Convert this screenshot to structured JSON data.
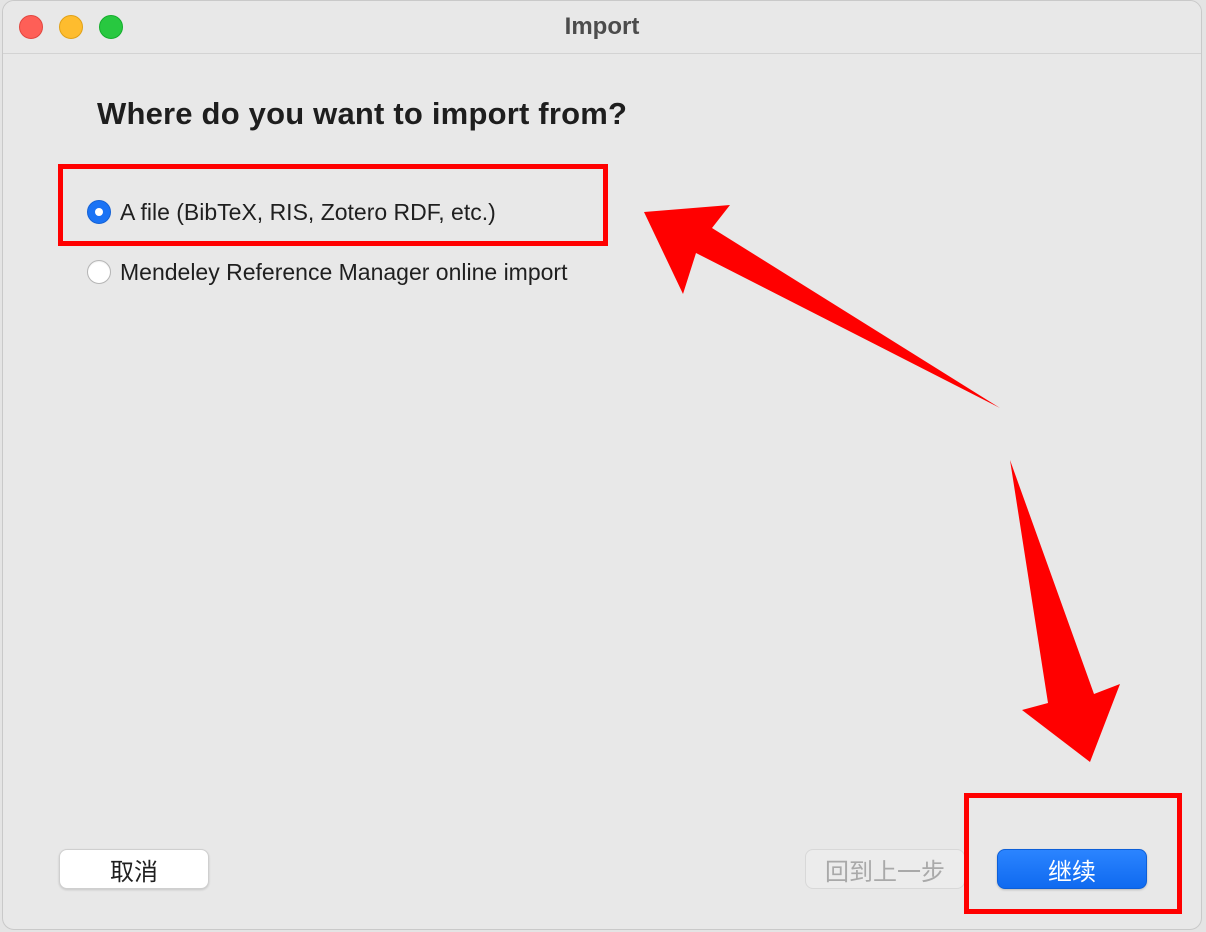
{
  "window": {
    "title": "Import",
    "traffic_lights": [
      "close",
      "minimize",
      "maximize"
    ]
  },
  "wizard": {
    "question": "Where do you want to import from?",
    "options": [
      {
        "label": "A file (BibTeX, RIS, Zotero RDF, etc.)",
        "selected": true
      },
      {
        "label": "Mendeley Reference Manager online import",
        "selected": false
      }
    ]
  },
  "buttons": {
    "cancel": "取消",
    "back": "回到上一步",
    "back_enabled": false,
    "continue": "继续"
  },
  "colors": {
    "accent": "#1a73f5",
    "annotation_red": "#ff0000"
  }
}
